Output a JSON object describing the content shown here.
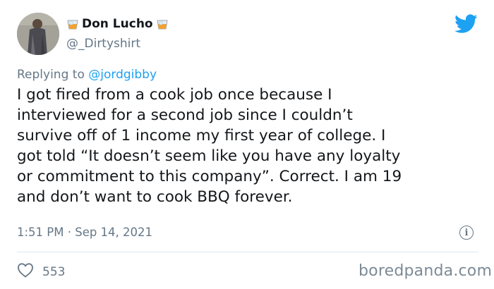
{
  "user": {
    "display_name": "Don Lucho",
    "handle": "@_Dirtyshirt",
    "name_emoji_left": "tumbler-glass-emoji",
    "name_emoji_right": "tumbler-glass-emoji"
  },
  "platform_icon": "twitter-bird-icon",
  "reply": {
    "prefix": "Replying to ",
    "mention": "@jordgibby"
  },
  "tweet": {
    "text": "I got fired from a cook job once because I\ninterviewed for a second job since I couldn’t\nsurvive off of 1 income my first year of college. I\ngot told “It doesn’t seem like you have any loyalty\nor commitment to this company”. Correct. I am 19\nand don’t want to cook BBQ forever.",
    "timestamp": "1:51 PM · Sep 14, 2021",
    "like_count": "553"
  },
  "watermark": "boredpanda.com",
  "colors": {
    "twitter_blue": "#1da1f2",
    "secondary_text": "#657786",
    "primary_text": "#14171a"
  }
}
